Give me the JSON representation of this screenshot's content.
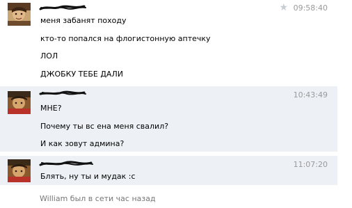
{
  "messages": [
    {
      "author": "",
      "time": "09:58:40",
      "highlighted": false,
      "lines": [
        "меня забанят походу",
        "кто-то попался на флогистонную аптечку",
        "ЛОЛ",
        "ДЖОБКУ ТЕБЕ ДАЛИ"
      ]
    },
    {
      "author": "",
      "time": "10:43:49",
      "highlighted": true,
      "lines": [
        "МНЕ?",
        "Почему ты вс ена меня свалил?",
        "И как зовут админа?"
      ]
    },
    {
      "author": "",
      "time": "11:07:20",
      "highlighted": true,
      "lines": [
        "Блять, ну ты и мудак :с"
      ]
    }
  ],
  "status": "William был в сети час назад",
  "icons": {
    "star": "star-icon"
  },
  "colors": {
    "highlight_bg": "#edf1f5",
    "time": "#999999",
    "status": "#777777",
    "scribble": "#111111"
  }
}
